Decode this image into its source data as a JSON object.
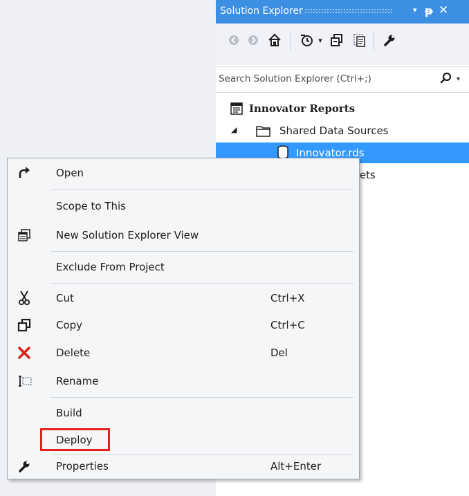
{
  "solution_explorer": {
    "title": "Solution Explorer",
    "title_dropdown": "▾",
    "pin": "ᵽ",
    "close": "✕",
    "search_placeholder": "Search Solution Explorer (Ctrl+;)",
    "search_dropdown": "▾",
    "toolbar_dropdown": "▾",
    "tree": [
      {
        "label": "Innovator Reports"
      },
      {
        "label": "Shared Data Sources",
        "expander": "◢"
      },
      {
        "label": "Innovator.rds"
      },
      {
        "label": "sets"
      }
    ]
  },
  "context_menu": {
    "items": [
      {
        "label": "Open",
        "icon": "open-arrow-icon"
      },
      {
        "label": "Scope to This"
      },
      {
        "label": "New Solution Explorer View",
        "icon": "new-view-icon"
      },
      {
        "label": "Exclude From Project"
      },
      {
        "label": "Cut",
        "shortcut": "Ctrl+X",
        "icon": "scissors-icon"
      },
      {
        "label": "Copy",
        "shortcut": "Ctrl+C",
        "icon": "copy-icon"
      },
      {
        "label": "Delete",
        "shortcut": "Del",
        "icon": "delete-x-icon"
      },
      {
        "label": "Rename",
        "icon": "rename-icon"
      },
      {
        "label": "Build"
      },
      {
        "label": "Deploy"
      },
      {
        "label": "Properties",
        "shortcut": "Alt+Enter",
        "icon": "wrench-icon"
      }
    ]
  },
  "colors": {
    "title_bar": "#3d8fe3",
    "selection": "#3399ff",
    "highlight_box": "#e2211c",
    "delete_icon": "#d6241b"
  }
}
